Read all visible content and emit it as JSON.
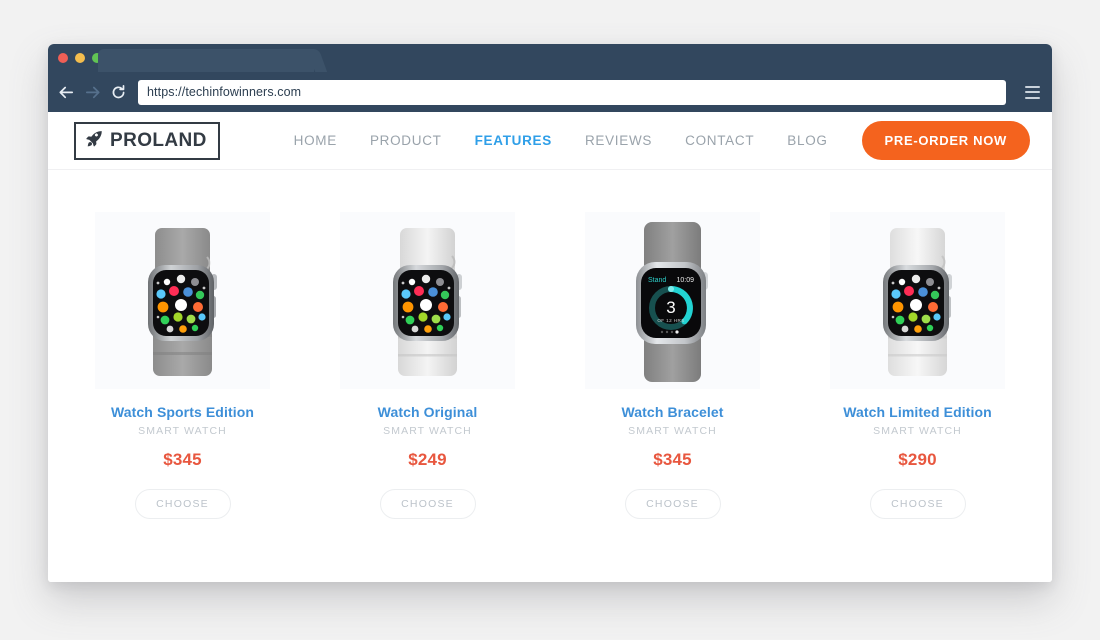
{
  "browser": {
    "traffic_lights": [
      "close",
      "minimize",
      "maximize"
    ],
    "url": "https://techinfowinners.com",
    "back_icon": "back-arrow-icon",
    "forward_icon": "forward-arrow-icon",
    "reload_icon": "reload-icon",
    "menu_icon": "hamburger-menu-icon"
  },
  "site": {
    "logo": {
      "text": "PROLAND",
      "icon": "rocket-icon"
    },
    "nav": [
      {
        "label": "HOME",
        "active": false
      },
      {
        "label": "PRODUCT",
        "active": false
      },
      {
        "label": "FEATURES",
        "active": true
      },
      {
        "label": "REVIEWS",
        "active": false
      },
      {
        "label": "CONTACT",
        "active": false
      },
      {
        "label": "BLOG",
        "active": false
      }
    ],
    "cta": {
      "label": "PRE-ORDER NOW"
    },
    "products": [
      {
        "title": "Watch Sports Edition",
        "subtitle": "SMART WATCH",
        "price": "$345",
        "button": "CHOOSE",
        "band_color": "#9a9a9a",
        "screen": "apps"
      },
      {
        "title": "Watch Original",
        "subtitle": "SMART WATCH",
        "price": "$249",
        "button": "CHOOSE",
        "band_color": "#e6e6e6",
        "screen": "apps"
      },
      {
        "title": "Watch Bracelet",
        "subtitle": "SMART WATCH",
        "price": "$345",
        "button": "CHOOSE",
        "band_color": "#8e8e8e",
        "screen": "stand",
        "stand": {
          "label": "Stand",
          "time": "10:09",
          "value": "3",
          "unit": "OF 12 HRS"
        }
      },
      {
        "title": "Watch Limited Edition",
        "subtitle": "SMART WATCH",
        "price": "$290",
        "button": "CHOOSE",
        "band_color": "#ededed",
        "screen": "apps"
      }
    ]
  },
  "colors": {
    "chrome": "#32475e",
    "accent_orange": "#f4631e",
    "link_blue": "#3d8fd8",
    "price_red": "#e8573f",
    "active_nav": "#2f9fe8"
  }
}
